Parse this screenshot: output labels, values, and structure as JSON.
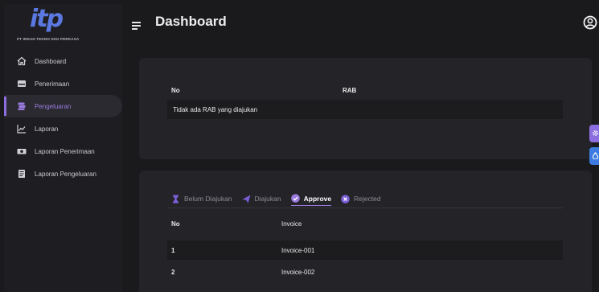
{
  "brand": {
    "logo_mark": "itp",
    "company_name": "PT INDAH TEKNO DIGI PERKASA"
  },
  "sidebar": {
    "items": [
      {
        "label": "Dashboard",
        "icon": "home-icon"
      },
      {
        "label": "Penerimaan",
        "icon": "inbox-icon"
      },
      {
        "label": "Pengeluaran",
        "icon": "money-stack-icon",
        "active": true
      },
      {
        "label": "Laporan",
        "icon": "chart-line-icon"
      },
      {
        "label": "Laporan Penerimaan",
        "icon": "cash-icon"
      },
      {
        "label": "Laporan Pengeluaran",
        "icon": "document-icon"
      }
    ]
  },
  "header": {
    "title": "Dashboard",
    "menu_icon": "hamburger-icon",
    "user_icon": "user-circle-icon"
  },
  "rab_card": {
    "columns": [
      "No",
      "RAB"
    ],
    "empty_message": "Tidak ada RAB yang diajukan"
  },
  "invoice_card": {
    "tabs": [
      {
        "label": "Belum Diajukan",
        "icon": "hourglass-icon"
      },
      {
        "label": "Diajukan",
        "icon": "send-icon"
      },
      {
        "label": "Approve",
        "icon": "check-circle-icon",
        "active": true
      },
      {
        "label": "Rejected",
        "icon": "x-circle-icon"
      }
    ],
    "columns": [
      "No",
      "Invoice"
    ],
    "rows": [
      {
        "no": "1",
        "invoice": "Invoice-001"
      },
      {
        "no": "2",
        "invoice": "Invoice-002"
      }
    ]
  },
  "floating_buttons": [
    {
      "icon": "gear-icon",
      "color": "#8c6ee0"
    },
    {
      "icon": "drop-icon",
      "color": "#3d7be0"
    }
  ],
  "colors": {
    "accent": "#9b7be0",
    "background": "#1a1a1d",
    "card": "#242428",
    "brand_blue": "#5a78e0"
  }
}
